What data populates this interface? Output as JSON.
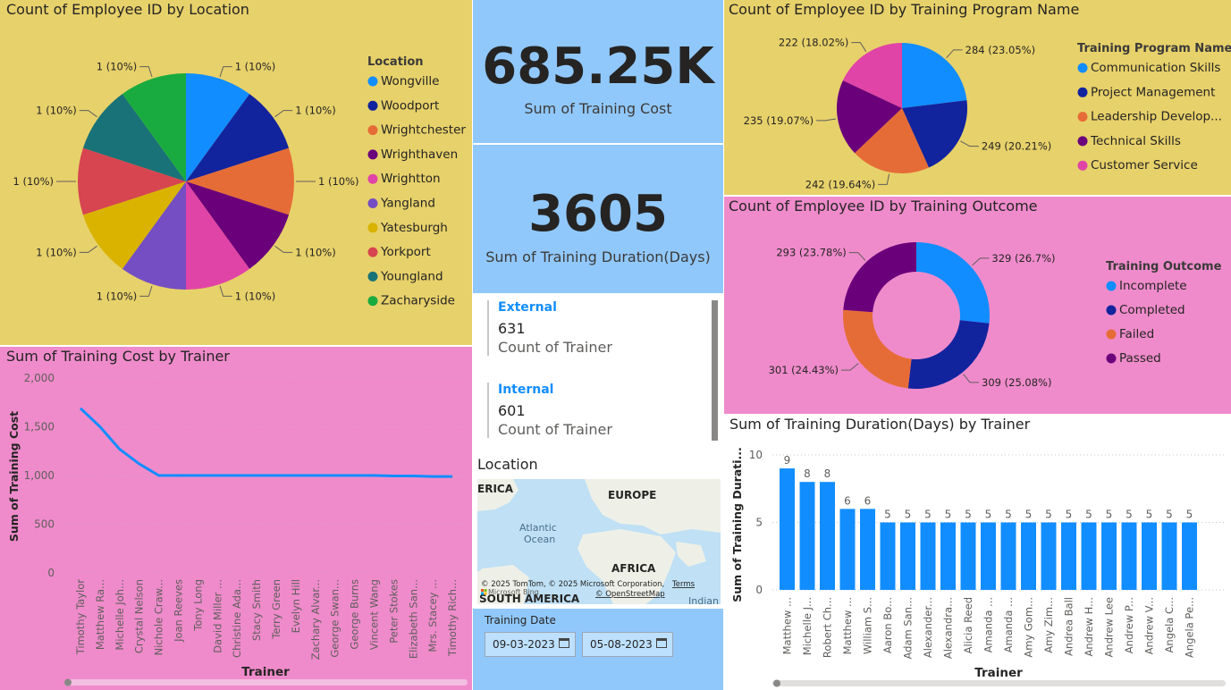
{
  "colors": {
    "yellow_bg": "#e7d16a",
    "pink_bg": "#ef8bcb",
    "blue_bg": "#91c8fb",
    "line_blue": "#118dff",
    "bar_blue": "#118dff"
  },
  "location_pie": {
    "title": "Count of Employee ID by Location",
    "legend_title": "Location",
    "chart_data": {
      "type": "pie",
      "title": "Count of Employee ID by Location",
      "categories": [
        "Wongville",
        "Woodport",
        "Wrightchester",
        "Wrighthaven",
        "Wrightton",
        "Yangland",
        "Yatesburgh",
        "Yorkport",
        "Youngland",
        "Zacharyside"
      ],
      "values": [
        1,
        1,
        1,
        1,
        1,
        1,
        1,
        1,
        1,
        1
      ],
      "colors": [
        "#118dff",
        "#12239e",
        "#e66c37",
        "#6b007b",
        "#e044a7",
        "#744ec2",
        "#d9b300",
        "#d64550",
        "#197278",
        "#1aab40"
      ],
      "labels": [
        "1 (10%)",
        "1 (10%)",
        "1 (10%)",
        "1 (10%)",
        "1 (10%)",
        "1 (10%)",
        "1 (10%)",
        "1 (10%)",
        "1 (10%)",
        "1 (10%)"
      ]
    }
  },
  "kpi_cost": {
    "value": "685.25K",
    "label": "Sum of Training Cost"
  },
  "kpi_duration": {
    "value": "3605",
    "label": "Sum of Training Duration(Days)"
  },
  "trainer_cards": [
    {
      "name": "External",
      "value": "631",
      "label": "Count of Trainer"
    },
    {
      "name": "Internal",
      "value": "601",
      "label": "Count of Trainer"
    }
  ],
  "map": {
    "title": "Location",
    "labels": [
      "ERICA",
      "EUROPE",
      "Atlantic",
      "Ocean",
      "AFRICA",
      "SOUTH AMERICA",
      "Indian"
    ],
    "copyright": "© 2025 TomTom, © 2025 Microsoft Corporation,",
    "terms": "Terms",
    "osm": "© OpenStreetMap",
    "bing": "Microsoft Bing"
  },
  "date_slicer": {
    "title": "Training Date",
    "start": "09-03-2023",
    "end": "05-08-2023"
  },
  "program_pie": {
    "title": "Count of Employee ID by Training Program Name",
    "legend_title": "Training Program Name",
    "chart_data": {
      "type": "pie",
      "title": "Count of Employee ID by Training Program Name",
      "categories": [
        "Communication Skills",
        "Project Management",
        "Leadership Develop...",
        "Technical Skills",
        "Customer Service"
      ],
      "values": [
        284,
        249,
        242,
        235,
        222
      ],
      "colors": [
        "#118dff",
        "#12239e",
        "#e66c37",
        "#6b007b",
        "#e044a7"
      ],
      "labels": [
        "284 (23.05%)",
        "249 (20.21%)",
        "242 (19.64%)",
        "235 (19.07%)",
        "222 (18.02%)"
      ]
    }
  },
  "outcome_donut": {
    "title": "Count of Employee ID by Training Outcome",
    "legend_title": "Training Outcome",
    "chart_data": {
      "type": "pie",
      "title": "Count of Employee ID by Training Outcome",
      "categories": [
        "Incomplete",
        "Completed",
        "Failed",
        "Passed"
      ],
      "values": [
        329,
        309,
        301,
        293
      ],
      "colors": [
        "#118dff",
        "#12239e",
        "#e66c37",
        "#6b007b"
      ],
      "labels": [
        "329 (26.7%)",
        "309 (25.08%)",
        "301 (24.43%)",
        "293 (23.78%)"
      ]
    }
  },
  "cost_line": {
    "title": "Sum of Training Cost by Trainer",
    "chart_data": {
      "type": "line",
      "title": "Sum of Training Cost by Trainer",
      "xlabel": "Trainer",
      "ylabel": "Sum of Training Cost",
      "ylim": [
        0,
        2000
      ],
      "yticks": [
        "0",
        "500",
        "1,000",
        "1,500",
        "2,000"
      ],
      "categories": [
        "Timothy Taylor",
        "Matthew Ra...",
        "Michelle Joh...",
        "Crystal Nelson",
        "Nichole Craw...",
        "Joan Reeves",
        "Tony Long",
        "David Miller ...",
        "Christine Ada...",
        "Stacy Smith",
        "Terry Green",
        "Evelyn Hill",
        "Zachary Alvar...",
        "George Swan...",
        "George Burns",
        "Vincent Wang",
        "Peter Stokes",
        "Elizabeth San...",
        "Mrs. Stacey ...",
        "Timothy Rich..."
      ],
      "values": [
        1690,
        1500,
        1270,
        1120,
        1000,
        1000,
        1000,
        1000,
        1000,
        1000,
        1000,
        1000,
        1000,
        1000,
        1000,
        1000,
        995,
        995,
        990,
        990
      ]
    }
  },
  "duration_bar": {
    "title": "Sum of Training Duration(Days) by Trainer",
    "chart_data": {
      "type": "bar",
      "title": "Sum of Training Duration(Days) by Trainer",
      "xlabel": "Trainer",
      "ylabel": "Sum of Training Durati...",
      "ylim": [
        0,
        10
      ],
      "yticks": [
        "0",
        "5",
        "10"
      ],
      "categories": [
        "Matthew ...",
        "Michelle J...",
        "Robert Ch...",
        "Matthew ...",
        "William S...",
        "Aaron Bo...",
        "Adam San...",
        "Alexander...",
        "Alexandra...",
        "Alicia Reed",
        "Amanda ...",
        "Amanda ...",
        "Amy Gom...",
        "Amy Zim...",
        "Andrea Ball",
        "Andrew H...",
        "Andrew Lee",
        "Andrew P...",
        "Andrew V...",
        "Angela C...",
        "Angela Pe..."
      ],
      "values": [
        9,
        8,
        8,
        6,
        6,
        5,
        5,
        5,
        5,
        5,
        5,
        5,
        5,
        5,
        5,
        5,
        5,
        5,
        5,
        5,
        5
      ]
    }
  }
}
